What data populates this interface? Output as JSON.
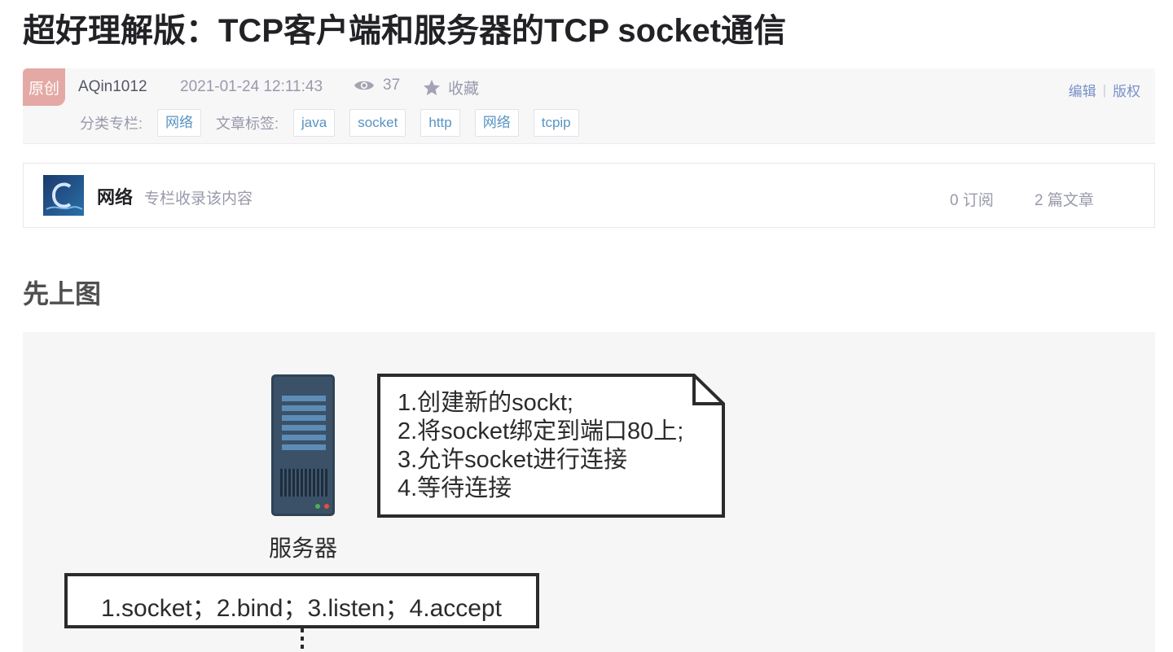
{
  "article": {
    "title": "超好理解版：TCP客户端和服务器的TCP socket通信",
    "badge": "原创",
    "author": "AQin1012",
    "date": "2021-01-24 12:11:43",
    "views": "37",
    "favorite_label": "收藏",
    "edit_label": "编辑",
    "separator": "|",
    "copyright_label": "版权",
    "category_label": "分类专栏:",
    "categories": [
      "网络"
    ],
    "tag_label": "文章标签:",
    "tags": [
      "java",
      "socket",
      "http",
      "网络",
      "tcpip"
    ]
  },
  "column": {
    "name": "网络",
    "description": "专栏收录该内容",
    "subscriptions": "0 订阅",
    "articles": "2 篇文章"
  },
  "content": {
    "heading": "先上图",
    "figure": {
      "note_lines": [
        "1.创建新的sockt;",
        "2.将socket绑定到端口80上;",
        "3.允许socket进行连接",
        "4.等待连接"
      ],
      "server_label": "服务器",
      "calls": "1.socket；2.bind；3.listen；4.accept"
    }
  },
  "icons": {
    "views": "eye-icon",
    "favorite": "star-icon"
  },
  "colors": {
    "badge_bg": "#e4a9a4",
    "tag_text": "#5893c2",
    "link": "#7691c6",
    "muted": "#999aaa"
  }
}
